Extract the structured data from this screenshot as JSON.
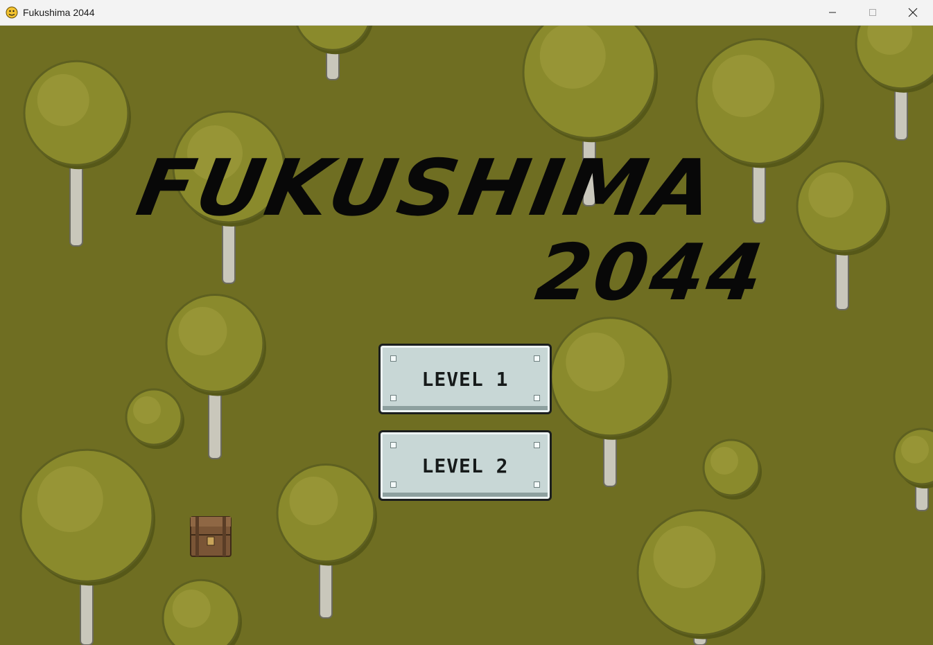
{
  "window": {
    "title": "Fukushima 2044",
    "controls": [
      "minimize-icon",
      "maximize-icon",
      "close-icon"
    ]
  },
  "game": {
    "title_line1": "FUKUSHIMA",
    "title_line2": "2044",
    "menu": [
      {
        "label": "LEVEL 1"
      },
      {
        "label": "LEVEL 2"
      }
    ]
  },
  "colors": {
    "grass": "#6f6e22",
    "foliage": "#8a8a2c",
    "title": "#080808",
    "button_face": "#c8d7d6"
  }
}
